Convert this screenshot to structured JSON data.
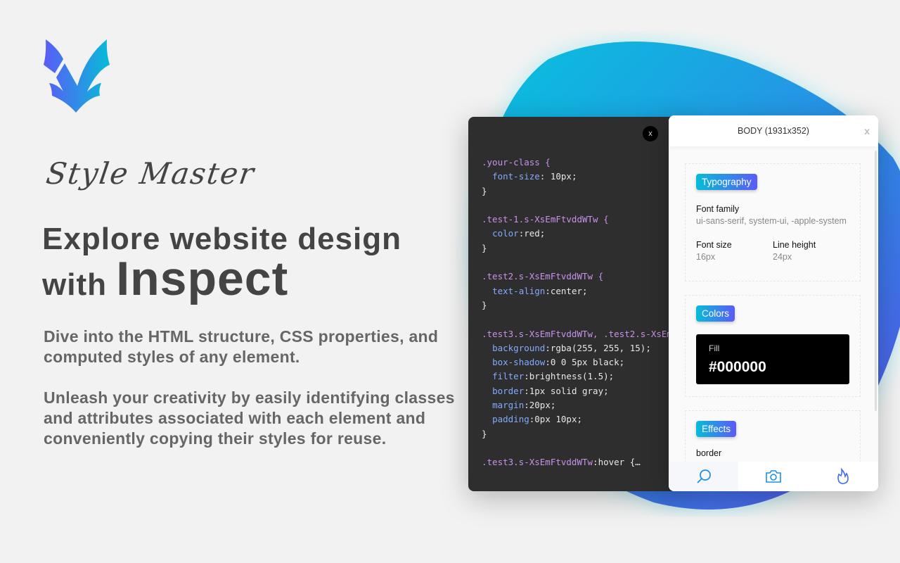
{
  "brand": {
    "name": "Style Master",
    "logo_icon": "v-wing-logo",
    "gradient": [
      "#5b5bf7",
      "#06bcd8"
    ]
  },
  "hero": {
    "line1": "Explore website design",
    "line2_small": "with ",
    "line2_big": "Inspect"
  },
  "descriptions": [
    "Dive into the HTML structure, CSS properties, and computed styles of any element.",
    "Unleash your creativity by easily identifying classes and attributes associated with each element and conveniently copying their styles for reuse."
  ],
  "code_panel": {
    "close_label": "x",
    "lines": [
      [
        {
          "c": "sel",
          "t": ".your-class {"
        }
      ],
      [
        {
          "c": "",
          "t": "  "
        },
        {
          "c": "prop",
          "t": "font-size"
        },
        {
          "c": "",
          "t": ": 10px;"
        }
      ],
      [
        {
          "c": "",
          "t": "}"
        }
      ],
      [
        {
          "c": "",
          "t": " "
        }
      ],
      [
        {
          "c": "sel",
          "t": ".test-1.s-XsEmFtvddWTw {"
        }
      ],
      [
        {
          "c": "",
          "t": "  "
        },
        {
          "c": "prop",
          "t": "color"
        },
        {
          "c": "",
          "t": ":red;"
        }
      ],
      [
        {
          "c": "",
          "t": "}"
        }
      ],
      [
        {
          "c": "",
          "t": " "
        }
      ],
      [
        {
          "c": "sel",
          "t": ".test2.s-XsEmFtvddWTw {"
        }
      ],
      [
        {
          "c": "",
          "t": "  "
        },
        {
          "c": "prop",
          "t": "text-align"
        },
        {
          "c": "",
          "t": ":center;"
        }
      ],
      [
        {
          "c": "",
          "t": "}"
        }
      ],
      [
        {
          "c": "",
          "t": " "
        }
      ],
      [
        {
          "c": "sel",
          "t": ".test3.s-XsEmFtvddWTw, .test2.s-XsEm"
        }
      ],
      [
        {
          "c": "",
          "t": "  "
        },
        {
          "c": "prop",
          "t": "background"
        },
        {
          "c": "",
          "t": ":rgba(255, 255, 15);"
        }
      ],
      [
        {
          "c": "",
          "t": "  "
        },
        {
          "c": "prop",
          "t": "box-shadow"
        },
        {
          "c": "",
          "t": ":0 0 5px black;"
        }
      ],
      [
        {
          "c": "",
          "t": "  "
        },
        {
          "c": "prop",
          "t": "filter"
        },
        {
          "c": "",
          "t": ":brightness(1.5);"
        }
      ],
      [
        {
          "c": "",
          "t": "  "
        },
        {
          "c": "prop",
          "t": "border"
        },
        {
          "c": "",
          "t": ":1px solid gray;"
        }
      ],
      [
        {
          "c": "",
          "t": "  "
        },
        {
          "c": "prop",
          "t": "margin"
        },
        {
          "c": "",
          "t": ":20px;"
        }
      ],
      [
        {
          "c": "",
          "t": "  "
        },
        {
          "c": "prop",
          "t": "padding"
        },
        {
          "c": "",
          "t": ":0px 10px;"
        }
      ],
      [
        {
          "c": "",
          "t": "}"
        }
      ],
      [
        {
          "c": "",
          "t": " "
        }
      ],
      [
        {
          "c": "sel",
          "t": ".test3.s-XsEmFtvddWTw"
        },
        {
          "c": "",
          "t": ":hover {…"
        }
      ]
    ]
  },
  "inspect_panel": {
    "title": "BODY (1931x352)",
    "close_label": "x",
    "typography": {
      "badge": "Typography",
      "font_family_label": "Font family",
      "font_family": "ui-sans-serif, system-ui, -apple-system",
      "font_size_label": "Font size",
      "font_size": "16px",
      "line_height_label": "Line height",
      "line_height": "24px"
    },
    "colors": {
      "badge": "Colors",
      "fill_label": "Fill",
      "fill_value": "#000000"
    },
    "effects": {
      "badge": "Effects",
      "border_label": "border"
    },
    "footer": {
      "tabs": [
        "search-icon",
        "camera-icon",
        "fire-icon"
      ],
      "active": 0
    }
  }
}
